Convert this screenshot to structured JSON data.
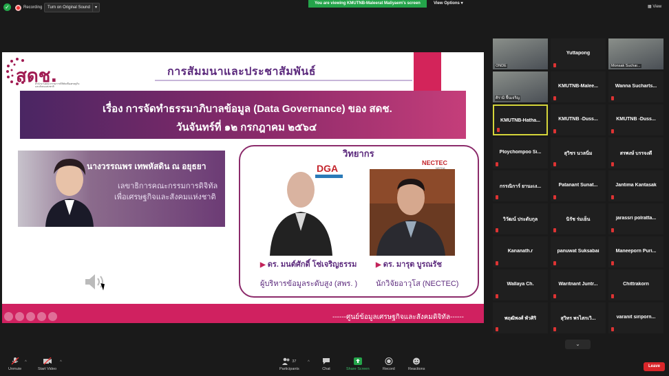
{
  "topbar": {
    "recording_label": "Recording",
    "audio_option": "Turn on Original Sound",
    "viewing_banner": "You are viewing KMUTNB-Maleerat Maliyaem's screen",
    "view_options": "View Options",
    "view": "View"
  },
  "slide": {
    "logo_text": "สดช.",
    "logo_sub": "สำนักงานคณะกรรมการดิจิทัลเพื่อเศรษฐกิจและสังคมแห่งชาติ",
    "title": "การสัมมนาและประชาสัมพันธ์",
    "banner_line1": "เรื่อง การจัดทำธรรมาภิบาลข้อมูล (Data Governance) ของ สดช.",
    "banner_line2": "วันจันทร์ที่ ๑๒ กรกฎาคม ๒๕๖๔",
    "host_name": "นางวรรณพร เทพหัสดิน ณ อยุธยา",
    "host_role1": "เลขาธิการคณะกรรมการดิจิทัล",
    "host_role2": "เพื่อเศรษฐกิจและสังคมแห่งชาติ",
    "speakers_heading": "วิทยากร",
    "dga_logo": "DGA",
    "nectec_logo": "NECTEC",
    "nectec_sub": "NSTDA",
    "speaker1_name": "ดร. มนต์ศักดิ์ โซ่เจริญธรรม",
    "speaker1_role": "ผู้บริหารข้อมูลระดับสูง (สพร. )",
    "speaker2_name": "ดร. มารุต บูรณรัช",
    "speaker2_role": "นักวิจัยอาวุโส (NECTEC)",
    "footer": "------ศูนย์ข้อมูลเศรษฐกิจและสังคมดิจิทัล------"
  },
  "participants": [
    {
      "name": "ONDE",
      "video": true
    },
    {
      "name": "Yuttapong",
      "video": false
    },
    {
      "name": "Monsak Suchar...",
      "video": true
    },
    {
      "name": "ศิรามิ ฟื้นเจริญ",
      "video": true
    },
    {
      "name": "KMUTNB-Malee...",
      "video": false
    },
    {
      "name": "Wanna Sucharts...",
      "video": false
    },
    {
      "name": "KMUTNB-Hatha...",
      "video": false,
      "active": true
    },
    {
      "name": "KMUTNB -Duss...",
      "video": false
    },
    {
      "name": "KMUTNB -Duss...",
      "video": false
    },
    {
      "name": "Ploychompoo Si...",
      "video": false
    },
    {
      "name": "สุวิชร นวลนิ่ม",
      "video": false
    },
    {
      "name": "สรพงษ์ บรรจงดี",
      "video": false
    },
    {
      "name": "กรรณิการ์ ยานะเง...",
      "video": false
    },
    {
      "name": "Patanant Sunat...",
      "video": false
    },
    {
      "name": "Jantima Kantasak",
      "video": false
    },
    {
      "name": "วิวัฒน์ ประดับกุล",
      "video": false
    },
    {
      "name": "นิรัช ร่มเย็น",
      "video": false
    },
    {
      "name": "jarassri polratta...",
      "video": false
    },
    {
      "name": "Kananath.r",
      "video": false
    },
    {
      "name": "panuwat Suksabai",
      "video": false
    },
    {
      "name": "Maneeporn Puri...",
      "video": false
    },
    {
      "name": "Wallaya Ch.",
      "video": false
    },
    {
      "name": "Waritnant Juntr...",
      "video": false
    },
    {
      "name": "Chittrakorn",
      "video": false
    },
    {
      "name": "พฤฒิพงศ์ พัวศิริ",
      "video": false
    },
    {
      "name": "สุวิทร พรไสกเวิ...",
      "video": false
    },
    {
      "name": "varanit siriporn...",
      "video": false
    }
  ],
  "toolbar": {
    "unmute": "Unmute",
    "start_video": "Start Video",
    "participants": "Participants",
    "participant_count": "37",
    "chat": "Chat",
    "share_screen": "Share Screen",
    "record": "Record",
    "reactions": "Reactions",
    "leave": "Leave"
  },
  "colors": {
    "green": "#24a44a",
    "slide_magenta": "#d02160",
    "slide_purple": "#5c2a7d",
    "leave_red": "#d9262a"
  }
}
